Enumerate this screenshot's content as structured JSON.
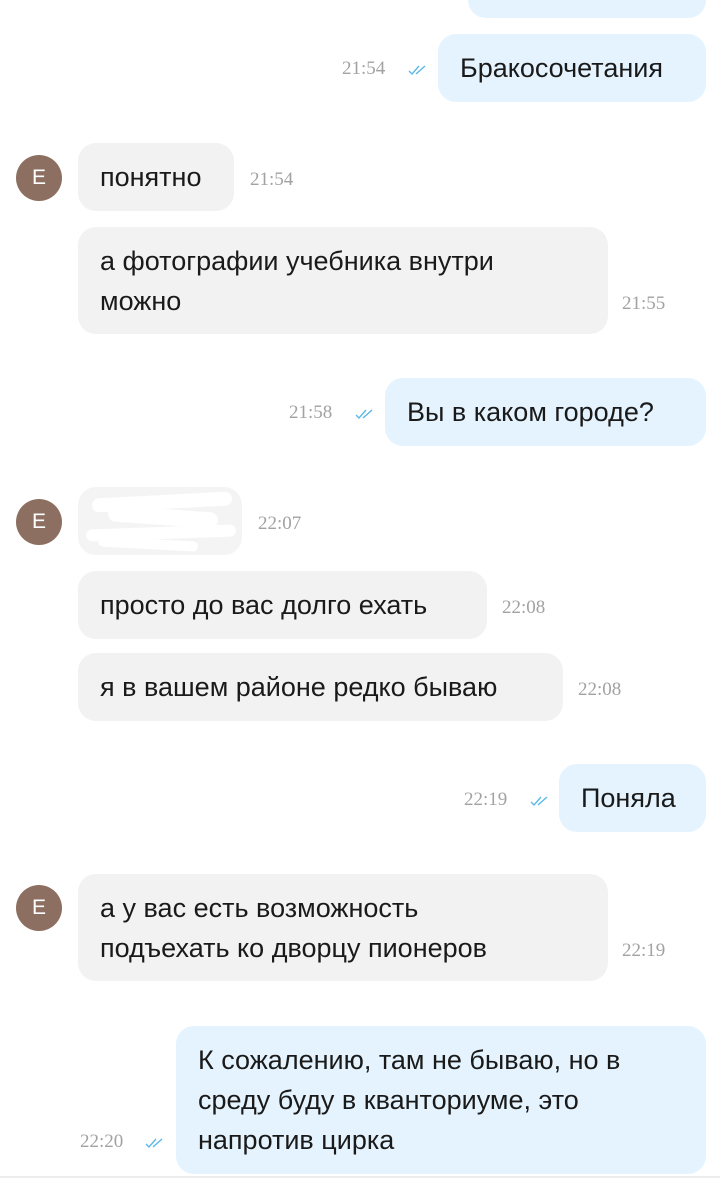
{
  "colors": {
    "incoming_bubble": "#f2f2f2",
    "outgoing_bubble": "#e4f3fd",
    "read_check": "#5cb8e6",
    "avatar": "#8d6f61",
    "time_text": "#a2a2a2"
  },
  "avatar_letter": "Е",
  "messages": [
    {
      "dir": "out",
      "text": "Бракосочетания",
      "time": "21:54",
      "status_icon": "double-check-icon"
    },
    {
      "dir": "in",
      "text": "понятно",
      "time": "21:54"
    },
    {
      "dir": "in",
      "text": "а фотографии учебника внутри\nможно",
      "time": "21:55"
    },
    {
      "dir": "out",
      "text": "Вы в каком городе?",
      "time": "21:58",
      "status_icon": "double-check-icon"
    },
    {
      "dir": "in",
      "text": "",
      "time": "22:07",
      "redacted": true
    },
    {
      "dir": "in",
      "text": "просто до вас долго ехать",
      "time": "22:08"
    },
    {
      "dir": "in",
      "text": "я в вашем районе редко бываю",
      "time": "22:08"
    },
    {
      "dir": "out",
      "text": "Поняла",
      "time": "22:19",
      "status_icon": "double-check-icon"
    },
    {
      "dir": "in",
      "text": "а у вас есть возможность\nподъехать ко дворцу пионеров",
      "time": "22:19"
    },
    {
      "dir": "out",
      "text": "К сожалению,  там не бываю, но в\nсреду буду в кванториуме, это\nнапротив цирка",
      "time": "22:20",
      "status_icon": "double-check-icon"
    }
  ]
}
